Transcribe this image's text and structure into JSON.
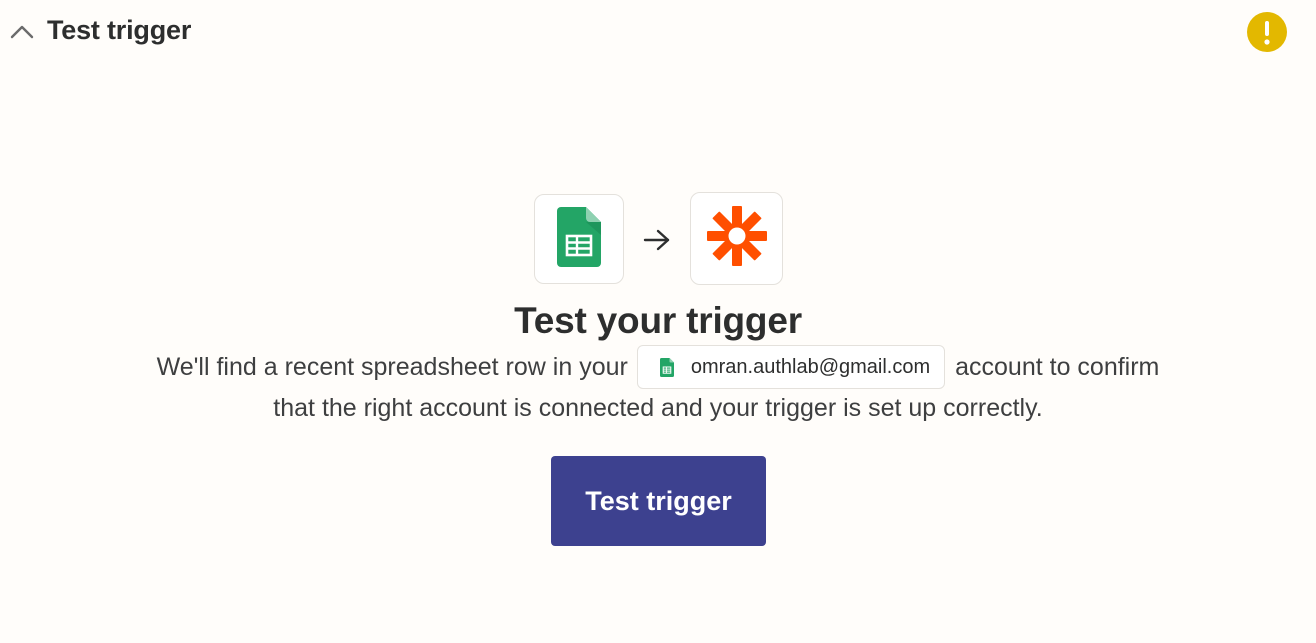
{
  "header": {
    "title": "Test trigger",
    "collapse_icon": "chevron-up-icon",
    "warning_icon": "warning-icon",
    "warning_color": "#e3b800"
  },
  "connection": {
    "source_app_icon": "google-sheets-icon",
    "arrow_icon": "arrow-right-icon",
    "target_app_icon": "zapier-icon",
    "sheets_color": "#23a566",
    "zapier_color": "#ff4f00"
  },
  "main": {
    "title": "Test your trigger",
    "description_before": "We'll find a recent spreadsheet row in your",
    "account_email": "omran.authlab@gmail.com",
    "description_after": "account to confirm",
    "description_line2": "that the right account is connected and your trigger is set up correctly."
  },
  "actions": {
    "test_button_label": "Test trigger",
    "button_color": "#3d418f"
  }
}
